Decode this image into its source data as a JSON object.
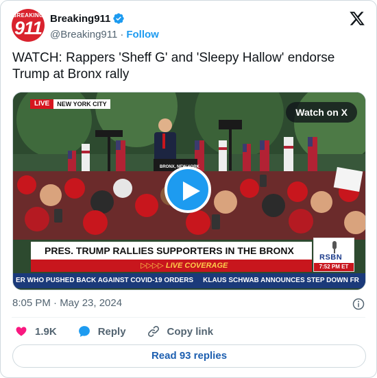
{
  "author": {
    "avatar_text_top": "BREAKING",
    "avatar_text_main": "911",
    "display_name": "Breaking911",
    "handle": "@Breaking911",
    "follow_label": "Follow",
    "verified_icon": "verified-badge-icon"
  },
  "platform_icon": "x-logo-icon",
  "tweet": {
    "text": "WATCH: Rappers 'Sheff G' and 'Sleepy Hallow' endorse Trump at Bronx rally",
    "timestamp": "8:05 PM · May 23, 2024"
  },
  "media": {
    "live_label": "LIVE",
    "location_label": "NEW YORK CITY",
    "watch_label": "Watch on X",
    "headline": "PRES. TRUMP RALLIES SUPPORTERS IN THE BRONX",
    "coverage_label": "▷▷▷▷ LIVE COVERAGE",
    "network": "RSBN",
    "network_time": "7:52 PM ET",
    "ticker_left": "ER WHO PUSHED BACK AGAINST COVID-19 ORDERS",
    "ticker_right": "KLAUS SCHWAB ANNOUNCES STEP DOWN FR",
    "podium_sign": "BRONX, NEW YORK"
  },
  "actions": {
    "like_count": "1.9K",
    "reply_label": "Reply",
    "copy_link_label": "Copy link"
  },
  "read_replies_label": "Read 93 replies",
  "colors": {
    "brand_blue": "#1d9bf0",
    "like_pink": "#f91880",
    "live_red": "#d6161f",
    "ticker_navy": "#1b3a7a"
  }
}
